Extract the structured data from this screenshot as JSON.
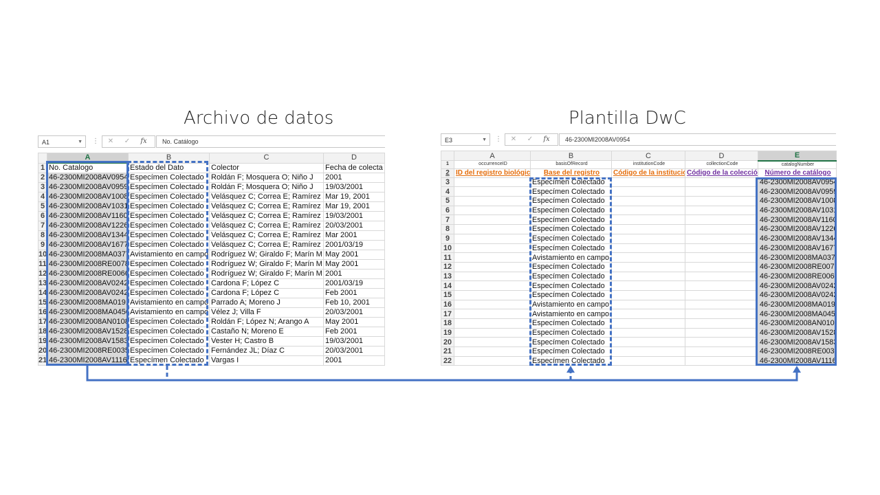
{
  "titles": {
    "left": "Archivo de datos",
    "right": "Plantilla DwC"
  },
  "left_sheet": {
    "name_box": "A1",
    "formula": "No. Catálogo",
    "columns": [
      "A",
      "B",
      "C",
      "D"
    ],
    "header": [
      "No. Catalogo",
      "Estado del Dato",
      "Colector",
      "Fecha de colecta"
    ],
    "rows": [
      [
        "46-2300MI2008AV0954",
        "Especímen Colectado",
        "Roldán F; Mosquera O; Niño J",
        "2001"
      ],
      [
        "46-2300MI2008AV0959",
        "Especímen Colectado",
        "Roldán F; Mosquera O; Niño J",
        "19/03/2001"
      ],
      [
        "46-2300MI2008AV1008",
        "Especímen Colectado",
        "Velásquez C; Correa E; Ramírez J",
        "Mar 19, 2001"
      ],
      [
        "46-2300MI2008AV1031",
        "Especímen Colectado",
        "Velásquez C; Correa E; Ramírez J",
        "Mar 19, 2001"
      ],
      [
        "46-2300MI2008AV1160",
        "Especímen Colectado",
        "Velásquez C; Correa E; Ramírez J",
        "19/03/2001"
      ],
      [
        "46-2300MI2008AV1226",
        "Especímen Colectado",
        "Velásquez C; Correa E; Ramírez J",
        "20/03/2001"
      ],
      [
        "46-2300MI2008AV1344",
        "Especímen Colectado",
        "Velásquez C; Correa E; Ramírez J",
        "Mar 2001"
      ],
      [
        "46-2300MI2008AV1677",
        "Especímen Colectado",
        "Velásquez C; Correa E; Ramírez J",
        "2001/03/19"
      ],
      [
        "46-2300MI2008MA0377",
        "Avistamiento en campo",
        "Rodríguez W; Giraldo F; Marín M",
        "May 2001"
      ],
      [
        "46-2300MI2008RE0078",
        "Especímen Colectado",
        "Rodríguez W; Giraldo F; Marín M",
        "May 2001"
      ],
      [
        "46-2300MI2008RE0066",
        "Especímen Colectado",
        "Rodríguez W; Giraldo F; Marín M",
        "2001"
      ],
      [
        "46-2300MI2008AV0242",
        "Especímen Colectado",
        "Cardona F; López C",
        "2001/03/19"
      ],
      [
        "46-2300MI2008AV0242",
        "Especímen Colectado",
        "Cardona F; López C",
        "Feb 2001"
      ],
      [
        "46-2300MI2008MA0191",
        "Avistamiento en campo",
        "Parrado A; Moreno J",
        "Feb 10, 2001"
      ],
      [
        "46-2300MI2008MA0450",
        "Avistamiento en campo",
        "Vélez J; Villa F",
        "20/03/2001"
      ],
      [
        "46-2300MI2008AN0108",
        "Especímen Colectado",
        "Roldán F; López N; Arango A",
        "May 2001"
      ],
      [
        "46-2300MI2008AV1528",
        "Especímen Colectado",
        "Castaño N; Moreno E",
        "Feb 2001"
      ],
      [
        "46-2300MI2008AV1583",
        "Especímen Colectado",
        "Vester H; Castro B",
        "19/03/2001"
      ],
      [
        "46-2300MI2008RE0035",
        "Especímen Colectado",
        "Fernández JL; Díaz C",
        "20/03/2001"
      ],
      [
        "46-2300MI2008AV1116",
        "Especímen Colectado",
        "Vargas I",
        "2001"
      ]
    ]
  },
  "right_sheet": {
    "name_box": "E3",
    "formula": "46-2300MI2008AV0954",
    "columns": [
      "A",
      "B",
      "C",
      "D",
      "E"
    ],
    "terms": [
      "occurrenceID",
      "basisOfRecord",
      "institutionCode",
      "collectionCode",
      "catalogNumber"
    ],
    "labels": [
      "ID del registro biológico",
      "Base del registro",
      "Código de la institución",
      "Código de la colección",
      "Número de catálogo"
    ],
    "label_colors": [
      "#e46c0a",
      "#e46c0a",
      "#e46c0a",
      "#7030a0",
      "#7030a0"
    ],
    "rows": [
      [
        "Especímen Colectado",
        "46-2300MI2008AV0954"
      ],
      [
        "Especímen Colectado",
        "46-2300MI2008AV0959"
      ],
      [
        "Especímen Colectado",
        "46-2300MI2008AV1008"
      ],
      [
        "Especímen Colectado",
        "46-2300MI2008AV1031"
      ],
      [
        "Especímen Colectado",
        "46-2300MI2008AV1160"
      ],
      [
        "Especímen Colectado",
        "46-2300MI2008AV1226"
      ],
      [
        "Especímen Colectado",
        "46-2300MI2008AV1344"
      ],
      [
        "Especímen Colectado",
        "46-2300MI2008AV1677"
      ],
      [
        "Avistamiento en campo",
        "46-2300MI2008MA0377"
      ],
      [
        "Especímen Colectado",
        "46-2300MI2008RE0078"
      ],
      [
        "Especímen Colectado",
        "46-2300MI2008RE0066"
      ],
      [
        "Especímen Colectado",
        "46-2300MI2008AV0242"
      ],
      [
        "Especímen Colectado",
        "46-2300MI2008AV0242"
      ],
      [
        "Avistamiento en campo",
        "46-2300MI2008MA0191"
      ],
      [
        "Avistamiento en campo",
        "46-2300MI2008MA0450"
      ],
      [
        "Especímen Colectado",
        "46-2300MI2008AN0108"
      ],
      [
        "Especímen Colectado",
        "46-2300MI2008AV1528"
      ],
      [
        "Especímen Colectado",
        "46-2300MI2008AV1583"
      ],
      [
        "Especímen Colectado",
        "46-2300MI2008RE0035"
      ],
      [
        "Especímen Colectado",
        "46-2300MI2008AV1116"
      ]
    ]
  },
  "colors": {
    "highlight": "#4472c4",
    "excel_green": "#217346"
  }
}
